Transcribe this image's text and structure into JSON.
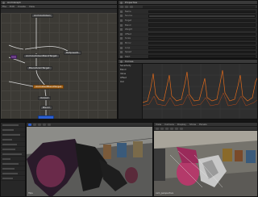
{
  "node_graph": {
    "title": "AnimGraph",
    "menu": [
      "File",
      "Edit",
      "Create",
      "View"
    ],
    "nodes": {
      "n1": "AnimAutoGen",
      "n2": "Refpose01",
      "n3": "AnimAutoGenBlendTarget",
      "n4": "BlendAnimTarget",
      "n5": "AnimatedBlendTarget",
      "n6": "Output",
      "n7": "Blend"
    },
    "colors": {
      "canvas": "#3c3a35",
      "orange_node": "#a8691f",
      "blue_node": "#2d5fcf",
      "wire": "#d9d9d9"
    }
  },
  "properties": {
    "title": "Properties",
    "rows": [
      "Name",
      "Source",
      "Target",
      "Blend",
      "Weight",
      "Offset",
      "Scale",
      "Mirror",
      "Loop",
      "Speed",
      "Start",
      "End"
    ],
    "highlight_row": 1
  },
  "curve_editor": {
    "title": "Curves",
    "channels": [
      "Sensitivity",
      "Blend",
      "Value",
      "Offset",
      "Out"
    ],
    "colors": {
      "curve": "#e06a1c",
      "curve2": "#b84a1a",
      "axis": "#4a4a4a"
    }
  },
  "viewport_left": {
    "label": "Hips"
  },
  "viewport_right": {
    "menu": [
      "View",
      "Camera",
      "Display",
      "Show",
      "Panels"
    ],
    "label": "cam_perspective"
  }
}
